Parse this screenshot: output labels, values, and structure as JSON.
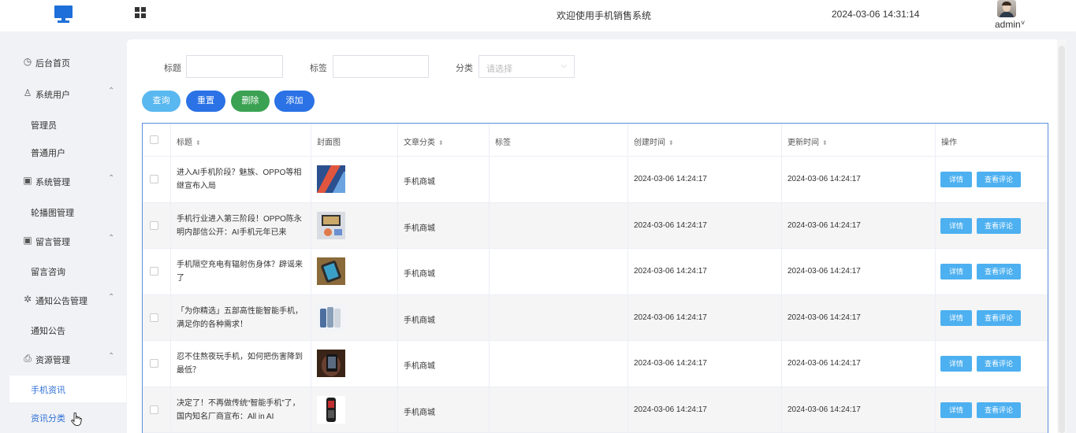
{
  "header": {
    "welcome": "欢迎使用手机销售系统",
    "datetime": "2024-03-06 14:31:14",
    "user": "admin",
    "caret": "˅"
  },
  "sidebar": {
    "groups": [
      {
        "label": "后台首页",
        "icon": "clock-icon",
        "glyph": "◷",
        "children": []
      },
      {
        "label": "系统用户",
        "icon": "user-icon",
        "glyph": "♙",
        "arrow": "⌃",
        "children": [
          "管理员",
          "普通用户"
        ]
      },
      {
        "label": "系统管理",
        "icon": "folder-icon",
        "glyph": "▣",
        "arrow": "⌃",
        "children": [
          "轮播图管理"
        ]
      },
      {
        "label": "留言管理",
        "icon": "folder-icon",
        "glyph": "▣",
        "arrow": "⌃",
        "children": [
          "留言咨询"
        ]
      },
      {
        "label": "通知公告管理",
        "icon": "loading-icon",
        "glyph": "✲",
        "arrow": "⌃",
        "children": [
          "通知公告"
        ]
      },
      {
        "label": "资源管理",
        "icon": "printer-icon",
        "glyph": "⎙",
        "arrow": "⌃",
        "children": [
          "手机资讯",
          "资讯分类"
        ]
      }
    ],
    "active_item": "手机资讯"
  },
  "filters": {
    "title_label": "标题",
    "tag_label": "标签",
    "category_label": "分类",
    "category_placeholder": "请选择",
    "chevron": "⌵"
  },
  "actions": {
    "query": "查询",
    "reset": "重置",
    "delete": "删除",
    "add": "添加"
  },
  "colors": {
    "query": "#5ab8f0",
    "reset": "#2a72e5",
    "delete": "#3aa252",
    "add": "#2a72e5",
    "op": "#4db0f0"
  },
  "table": {
    "headers": {
      "title": "标题",
      "cover": "封面图",
      "category": "文章分类",
      "tags": "标签",
      "created": "创建时间",
      "updated": "更新时间",
      "ops": "操作",
      "sort": "⬍"
    },
    "rows": [
      {
        "title": "进入AI手机阶段？魅族、OPPO等相继宣布入局",
        "category": "手机商城",
        "tags": "",
        "created": "2024-03-06 14:24:17",
        "updated": "2024-03-06 14:24:17",
        "detail": "详情",
        "comments": "查看评论"
      },
      {
        "title": "手机行业进入第三阶段！OPPO陈永明内部信公开：AI手机元年已来",
        "category": "手机商城",
        "tags": "",
        "created": "2024-03-06 14:24:17",
        "updated": "2024-03-06 14:24:17",
        "detail": "详情",
        "comments": "查看评论"
      },
      {
        "title": "手机隔空充电有辐射伤身体？辟谣来了",
        "category": "手机商城",
        "tags": "",
        "created": "2024-03-06 14:24:17",
        "updated": "2024-03-06 14:24:17",
        "detail": "详情",
        "comments": "查看评论"
      },
      {
        "title": "「为你精选」五部高性能智能手机，满足你的各种需求！",
        "category": "手机商城",
        "tags": "",
        "created": "2024-03-06 14:24:17",
        "updated": "2024-03-06 14:24:17",
        "detail": "详情",
        "comments": "查看评论"
      },
      {
        "title": "忍不住熬夜玩手机，如何把伤害降到最低？",
        "category": "手机商城",
        "tags": "",
        "created": "2024-03-06 14:24:17",
        "updated": "2024-03-06 14:24:17",
        "detail": "详情",
        "comments": "查看评论"
      },
      {
        "title": "决定了！不再做传统“智能手机”了，国内知名厂商宣布：All in AI",
        "category": "手机商城",
        "tags": "",
        "created": "2024-03-06 14:24:17",
        "updated": "2024-03-06 14:24:17",
        "detail": "详情",
        "comments": "查看评论"
      }
    ]
  }
}
